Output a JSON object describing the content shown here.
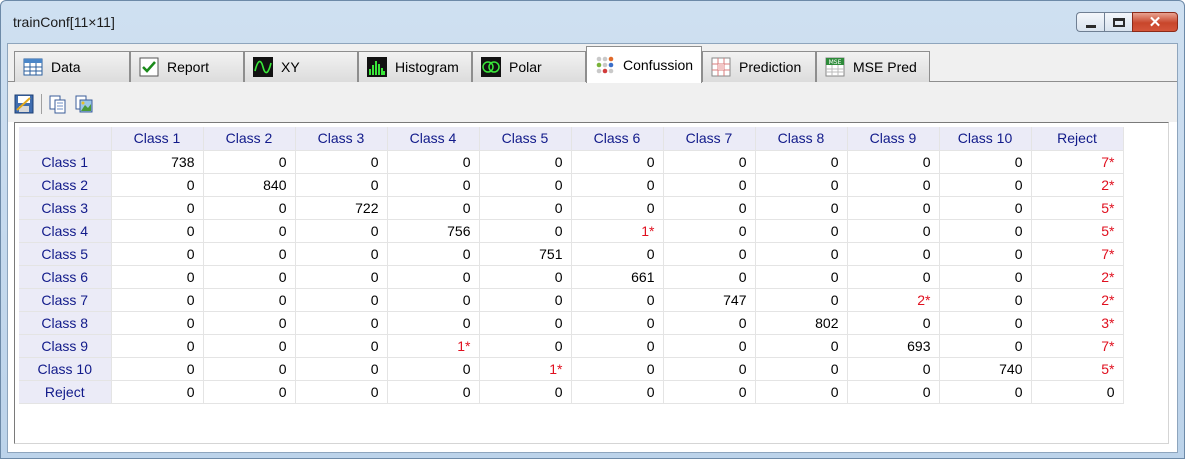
{
  "window": {
    "title": "trainConf[11×11]"
  },
  "tabs": [
    {
      "label": "Data",
      "icon": "table-icon"
    },
    {
      "label": "Report",
      "icon": "checkmark-icon"
    },
    {
      "label": "XY",
      "icon": "wave-icon"
    },
    {
      "label": "Histogram",
      "icon": "histogram-icon"
    },
    {
      "label": "Polar",
      "icon": "polar-icon"
    },
    {
      "label": "Confussion",
      "icon": "dots-icon",
      "active": true
    },
    {
      "label": "Prediction",
      "icon": "grid-icon"
    },
    {
      "label": "MSE Pred",
      "icon": "mse-icon"
    }
  ],
  "toolbar": {
    "icons": [
      "save-icon",
      "copy-icon",
      "export-image-icon"
    ]
  },
  "colors": {
    "header_text": "#111a8a",
    "header_bg": "#ebebf7",
    "error_text": "#e0101f"
  },
  "matrix": {
    "columns": [
      "Class 1",
      "Class 2",
      "Class 3",
      "Class 4",
      "Class 5",
      "Class 6",
      "Class 7",
      "Class 8",
      "Class 9",
      "Class 10",
      "Reject"
    ],
    "rows": [
      {
        "label": "Class 1",
        "cells": [
          "738",
          "0",
          "0",
          "0",
          "0",
          "0",
          "0",
          "0",
          "0",
          "0",
          "7*"
        ]
      },
      {
        "label": "Class 2",
        "cells": [
          "0",
          "840",
          "0",
          "0",
          "0",
          "0",
          "0",
          "0",
          "0",
          "0",
          "2*"
        ]
      },
      {
        "label": "Class 3",
        "cells": [
          "0",
          "0",
          "722",
          "0",
          "0",
          "0",
          "0",
          "0",
          "0",
          "0",
          "5*"
        ]
      },
      {
        "label": "Class 4",
        "cells": [
          "0",
          "0",
          "0",
          "756",
          "0",
          "1*",
          "0",
          "0",
          "0",
          "0",
          "5*"
        ]
      },
      {
        "label": "Class 5",
        "cells": [
          "0",
          "0",
          "0",
          "0",
          "751",
          "0",
          "0",
          "0",
          "0",
          "0",
          "7*"
        ]
      },
      {
        "label": "Class 6",
        "cells": [
          "0",
          "0",
          "0",
          "0",
          "0",
          "661",
          "0",
          "0",
          "0",
          "0",
          "2*"
        ]
      },
      {
        "label": "Class 7",
        "cells": [
          "0",
          "0",
          "0",
          "0",
          "0",
          "0",
          "747",
          "0",
          "2*",
          "0",
          "2*"
        ]
      },
      {
        "label": "Class 8",
        "cells": [
          "0",
          "0",
          "0",
          "0",
          "0",
          "0",
          "0",
          "802",
          "0",
          "0",
          "3*"
        ]
      },
      {
        "label": "Class 9",
        "cells": [
          "0",
          "0",
          "0",
          "1*",
          "0",
          "0",
          "0",
          "0",
          "693",
          "0",
          "7*"
        ]
      },
      {
        "label": "Class 10",
        "cells": [
          "0",
          "0",
          "0",
          "0",
          "1*",
          "0",
          "0",
          "0",
          "0",
          "740",
          "5*"
        ]
      },
      {
        "label": "Reject",
        "cells": [
          "0",
          "0",
          "0",
          "0",
          "0",
          "0",
          "0",
          "0",
          "0",
          "0",
          "0"
        ]
      }
    ]
  }
}
